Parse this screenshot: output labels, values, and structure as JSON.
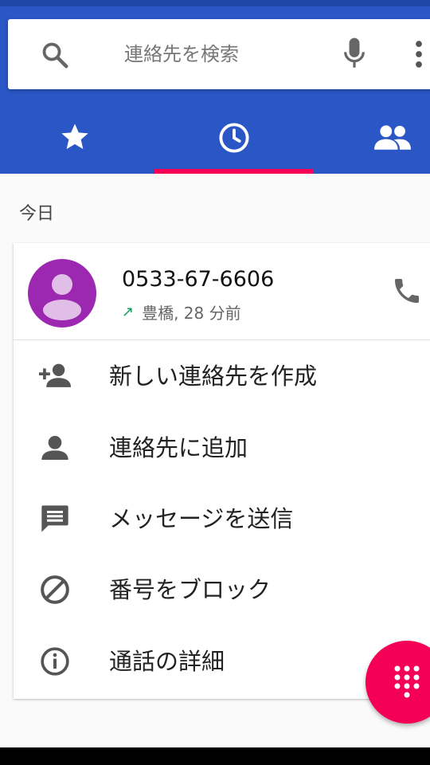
{
  "search": {
    "placeholder": "連絡先を検索"
  },
  "tabs": [
    {
      "name": "favorites",
      "icon": "star-icon",
      "selected": false
    },
    {
      "name": "recents",
      "icon": "clock-icon",
      "selected": true
    },
    {
      "name": "contacts",
      "icon": "people-icon",
      "selected": false
    }
  ],
  "section": {
    "title": "今日"
  },
  "call": {
    "number": "0533-67-6606",
    "direction_icon": "outgoing-arrow-icon",
    "location_time": "豊橋, 28 分前"
  },
  "menu": [
    {
      "label": "新しい連絡先を作成",
      "icon": "person-add-icon"
    },
    {
      "label": "連絡先に追加",
      "icon": "person-icon"
    },
    {
      "label": "メッセージを送信",
      "icon": "message-icon"
    },
    {
      "label": "番号をブロック",
      "icon": "block-icon"
    },
    {
      "label": "通話の詳細",
      "icon": "info-icon"
    }
  ],
  "colors": {
    "appbar": "#2a56c6",
    "accent": "#f50057",
    "avatar": "#9c27b0",
    "outgoing": "#0f9d58"
  }
}
